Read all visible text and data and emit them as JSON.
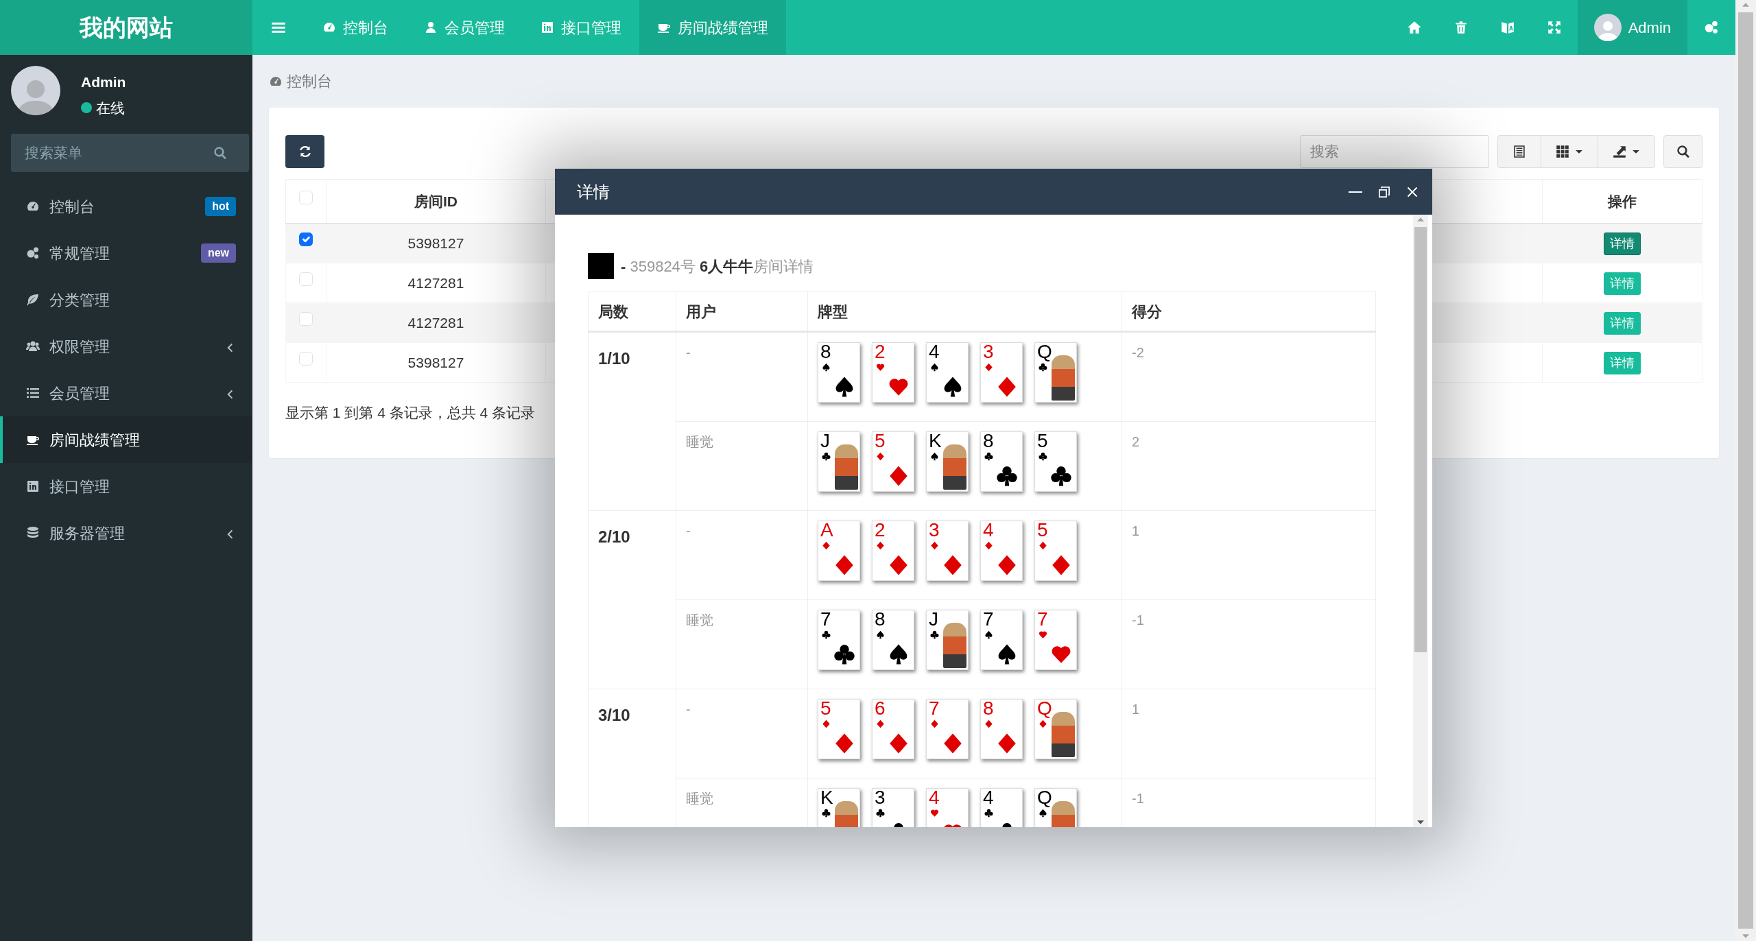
{
  "header": {
    "logo": "我的网站",
    "nav": [
      {
        "label": "控制台",
        "selected": false
      },
      {
        "label": "会员管理",
        "selected": false
      },
      {
        "label": "接口管理",
        "selected": false
      },
      {
        "label": "房间战绩管理",
        "selected": true
      }
    ],
    "user": {
      "name": "Admin",
      "active": true
    }
  },
  "sidebar": {
    "user": {
      "name": "Admin",
      "status": "在线"
    },
    "search": {
      "placeholder": "搜索菜单"
    },
    "items": [
      {
        "label": "控制台",
        "badge": "hot",
        "color": "#0073b7",
        "submenu": false,
        "selected": false
      },
      {
        "label": "常规管理",
        "badge": "new",
        "color": "#605ca8",
        "submenu": false,
        "selected": false
      },
      {
        "label": "分类管理",
        "submenu": false,
        "selected": false
      },
      {
        "label": "权限管理",
        "submenu": true,
        "selected": false
      },
      {
        "label": "会员管理",
        "submenu": true,
        "selected": false
      },
      {
        "label": "房间战绩管理",
        "submenu": false,
        "selected": true
      },
      {
        "label": "接口管理",
        "submenu": false,
        "selected": false
      },
      {
        "label": "服务器管理",
        "submenu": true,
        "selected": false
      }
    ]
  },
  "breadcrumb": {
    "label": "控制台"
  },
  "toolbar": {
    "search": {
      "placeholder": "搜索"
    }
  },
  "table": {
    "columns": [
      "房间ID",
      "操作"
    ],
    "select_all": false,
    "rows": [
      {
        "checked": true,
        "room_id": "5398127",
        "action": "详情",
        "action_active": true
      },
      {
        "checked": false,
        "room_id": "4127281",
        "action": "详情",
        "action_active": false
      },
      {
        "checked": false,
        "room_id": "4127281",
        "action": "详情",
        "action_active": false
      },
      {
        "checked": false,
        "room_id": "5398127",
        "action": "详情",
        "action_active": false
      }
    ]
  },
  "pagination": "显示第 1 到第 4 条记录，总共 4 条记录",
  "modal": {
    "title": "详情",
    "heading": "**-** 359824号 **6人牛牛**房间详情",
    "columns": [
      "局数",
      "用户",
      "牌型",
      "得分"
    ],
    "rounds": [
      {
        "label": "1/10",
        "players": [
          {
            "user": "-",
            "score": "-2",
            "cards": [
              {
                "rank": "8",
                "kind": "spades",
                "face": false
              },
              {
                "rank": "2",
                "kind": "hearts",
                "face": false
              },
              {
                "rank": "4",
                "kind": "spades",
                "face": false
              },
              {
                "rank": "3",
                "kind": "diamonds",
                "face": false
              },
              {
                "rank": "Q",
                "kind": "clubs",
                "face": true
              }
            ]
          },
          {
            "user": "睡觉",
            "score": "2",
            "cards": [
              {
                "rank": "J",
                "kind": "clubs",
                "face": true
              },
              {
                "rank": "5",
                "kind": "diamonds",
                "face": false
              },
              {
                "rank": "K",
                "kind": "spades",
                "face": true
              },
              {
                "rank": "8",
                "kind": "clubs",
                "face": false
              },
              {
                "rank": "5",
                "kind": "clubs",
                "face": false
              }
            ]
          }
        ]
      },
      {
        "label": "2/10",
        "players": [
          {
            "user": "-",
            "score": "1",
            "cards": [
              {
                "rank": "A",
                "kind": "diamonds",
                "face": false
              },
              {
                "rank": "2",
                "kind": "diamonds",
                "face": false
              },
              {
                "rank": "3",
                "kind": "diamonds",
                "face": false
              },
              {
                "rank": "4",
                "kind": "diamonds",
                "face": false
              },
              {
                "rank": "5",
                "kind": "diamonds",
                "face": false
              }
            ]
          },
          {
            "user": "睡觉",
            "score": "-1",
            "cards": [
              {
                "rank": "7",
                "kind": "clubs",
                "face": false
              },
              {
                "rank": "8",
                "kind": "spades",
                "face": false
              },
              {
                "rank": "J",
                "kind": "clubs",
                "face": true
              },
              {
                "rank": "7",
                "kind": "spades",
                "face": false
              },
              {
                "rank": "7",
                "kind": "hearts",
                "face": false
              }
            ]
          }
        ]
      },
      {
        "label": "3/10",
        "players": [
          {
            "user": "-",
            "score": "1",
            "cards": [
              {
                "rank": "5",
                "kind": "diamonds",
                "face": false
              },
              {
                "rank": "6",
                "kind": "diamonds",
                "face": false
              },
              {
                "rank": "7",
                "kind": "diamonds",
                "face": false
              },
              {
                "rank": "8",
                "kind": "diamonds",
                "face": false
              },
              {
                "rank": "Q",
                "kind": "diamonds",
                "face": true
              }
            ]
          },
          {
            "user": "睡觉",
            "score": "-1",
            "cards": [
              {
                "rank": "K",
                "kind": "clubs",
                "face": true
              },
              {
                "rank": "3",
                "kind": "clubs",
                "face": false
              },
              {
                "rank": "4",
                "kind": "hearts",
                "face": false
              },
              {
                "rank": "4",
                "kind": "clubs",
                "face": false
              },
              {
                "rank": "Q",
                "kind": "spades",
                "face": true
              }
            ]
          }
        ]
      }
    ]
  }
}
